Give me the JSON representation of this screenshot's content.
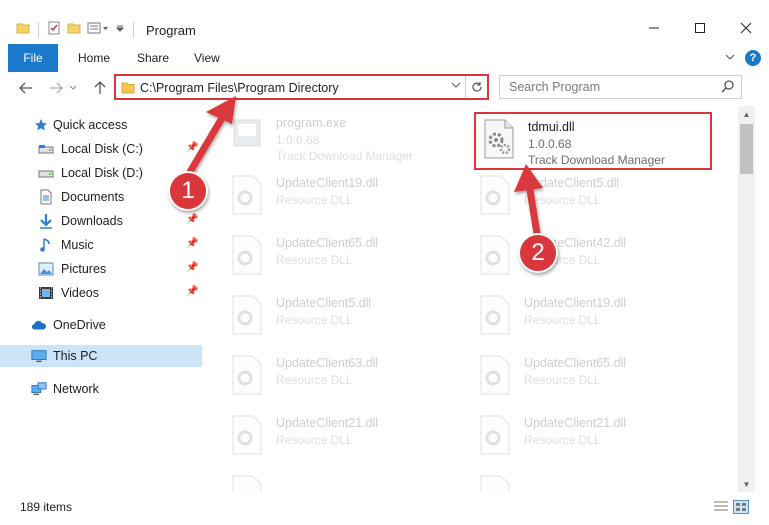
{
  "window": {
    "title": "Program",
    "minimize_glyph": "—",
    "maximize_glyph": "☐",
    "close_glyph": "✕"
  },
  "ribbon": {
    "file": "File",
    "home": "Home",
    "share": "Share",
    "view": "View",
    "help": "?"
  },
  "nav": {
    "back": "←",
    "forward": "→",
    "up": "↑",
    "recent": "⌄",
    "address": "C:\\Program Files\\Program Directory",
    "search_placeholder": "Search Program"
  },
  "sidebar": {
    "quick_access": "Quick access",
    "items": [
      {
        "label": "Local Disk (C:)",
        "icon": "drive-icon",
        "pinned": true
      },
      {
        "label": "Local Disk (D:)",
        "icon": "drive-icon",
        "pinned": false
      },
      {
        "label": "Documents",
        "icon": "documents-icon",
        "pinned": true
      },
      {
        "label": "Downloads",
        "icon": "downloads-icon",
        "pinned": true
      },
      {
        "label": "Music",
        "icon": "music-icon",
        "pinned": true
      },
      {
        "label": "Pictures",
        "icon": "pictures-icon",
        "pinned": true
      },
      {
        "label": "Videos",
        "icon": "videos-icon",
        "pinned": true
      }
    ],
    "onedrive": "OneDrive",
    "this_pc": "This PC",
    "network": "Network"
  },
  "files": {
    "highlighted": {
      "name": "tdmui.dll",
      "version": "1.0.0.68",
      "company": "Track Download Manager"
    },
    "others": [
      {
        "name": "program.exe",
        "sub": "1.0.0.68",
        "sub2": "Track Download Manager"
      },
      {
        "name": "UpdateClient19.dll",
        "sub": "Resource DLL"
      },
      {
        "name": "UpdateClient5.dll",
        "sub": "Resource DLL"
      },
      {
        "name": "UpdateClient65.dll",
        "sub": "Resource DLL"
      },
      {
        "name": "UpdateClient42.dll",
        "sub": "Resource DLL"
      },
      {
        "name": "UpdateClient5.dll",
        "sub": "Resource DLL"
      },
      {
        "name": "UpdateClient19.dll",
        "sub": "Resource DLL"
      },
      {
        "name": "UpdateClient63.dll",
        "sub": "Resource DLL"
      },
      {
        "name": "UpdateClient65.dll",
        "sub": "Resource DLL"
      },
      {
        "name": "UpdateClient21.dll",
        "sub": "Resource DLL"
      },
      {
        "name": "UpdateClient21.dll",
        "sub": "Resource DLL"
      }
    ]
  },
  "status": {
    "item_count": "189 items"
  },
  "callouts": {
    "step1": "1",
    "step2": "2"
  },
  "colors": {
    "accent": "#1979ca",
    "callout_red": "#d9373c",
    "selected_bg": "#cce4f7"
  }
}
